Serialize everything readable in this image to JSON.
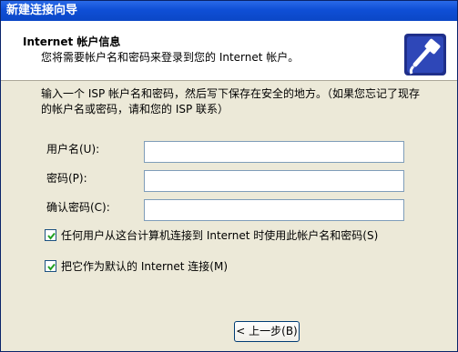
{
  "window": {
    "title": "新建连接向导"
  },
  "header": {
    "title": "Internet 帐户信息",
    "subtitle": "您将需要帐户名和密码来登录到您的 Internet 帐户。"
  },
  "intro": {
    "line1": "输入一个 ISP 帐户名和密码，然后写下保存在安全的地方。（如果您忘记了现存",
    "line2": "的帐户名或密码，请和您的 ISP 联系）"
  },
  "form": {
    "username_label": "用户名(U):",
    "username_value": "",
    "password_label": "密码(P):",
    "password_value": "",
    "confirm_label": "确认密码(C):",
    "confirm_value": ""
  },
  "options": {
    "any_user_label": "任何用户从这台计算机连接到 Internet 时使用此帐户名和密码(S)",
    "any_user_checked": true,
    "default_label": "把它作为默认的 Internet 连接(M)",
    "default_checked": true
  },
  "buttons": {
    "back_label": "< 上一步(B)"
  },
  "icons": {
    "header_icon": "network-cable-plug-icon"
  }
}
